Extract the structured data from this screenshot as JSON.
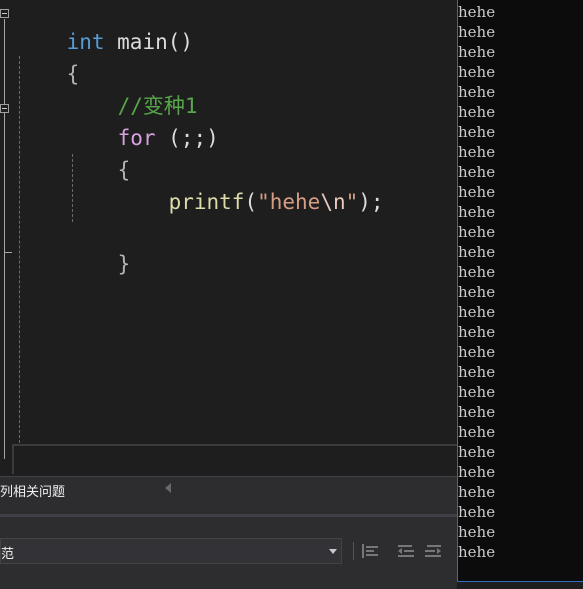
{
  "editor": {
    "lines": [
      {
        "parts": [
          {
            "cls": "kw",
            "text": "int"
          },
          {
            "cls": "",
            "text": " main()"
          }
        ]
      },
      {
        "parts": [
          {
            "cls": "brace",
            "text": "{"
          }
        ]
      },
      {
        "parts": [
          {
            "cls": "comment",
            "text": "//变种1"
          }
        ]
      },
      {
        "parts": [
          {
            "cls": "kw-ctrl",
            "text": "for"
          },
          {
            "cls": "",
            "text": " (;;)"
          }
        ]
      },
      {
        "parts": [
          {
            "cls": "brace",
            "text": "{"
          }
        ]
      },
      {
        "parts": [
          {
            "cls": "fn",
            "text": "printf"
          },
          {
            "cls": "",
            "text": "("
          },
          {
            "cls": "str",
            "text": "\"hehe"
          },
          {
            "cls": "esc",
            "text": "\\n"
          },
          {
            "cls": "str",
            "text": "\""
          },
          {
            "cls": "",
            "text": ");"
          }
        ]
      },
      {
        "parts": [
          {
            "cls": "brace",
            "text": "}"
          }
        ]
      }
    ]
  },
  "panel": {
    "tab_label": "列相关问题",
    "dropdown_value": "范"
  },
  "toolbar_icons": [
    "align-left-icon",
    "indent-left-icon",
    "indent-right-icon"
  ],
  "console": {
    "lines": [
      "hehe",
      "hehe",
      "hehe",
      "hehe",
      "hehe",
      "hehe",
      "hehe",
      "hehe",
      "hehe",
      "hehe",
      "hehe",
      "hehe",
      "hehe",
      "hehe",
      "hehe",
      "hehe",
      "hehe",
      "hehe",
      "hehe",
      "hehe",
      "hehe",
      "hehe",
      "hehe",
      "hehe",
      "hehe",
      "hehe",
      "hehe",
      "hehe"
    ]
  }
}
